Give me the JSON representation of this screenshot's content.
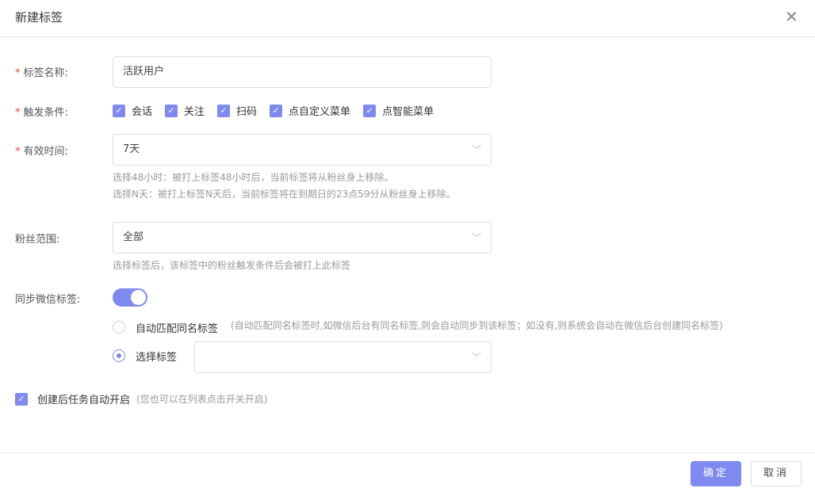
{
  "dialog": {
    "title": "新建标签"
  },
  "form": {
    "name": {
      "label": "标签名称:",
      "value": "活跃用户"
    },
    "trigger": {
      "label": "触发条件:",
      "options": [
        "会话",
        "关注",
        "扫码",
        "点自定义菜单",
        "点智能菜单"
      ]
    },
    "validity": {
      "label": "有效时间:",
      "value": "7天",
      "hint1": "选择48小时：被打上标签48小时后，当前标签将从粉丝身上移除。",
      "hint2": "选择N天：被打上标签N天后，当前标签将在到期日的23点59分从粉丝身上移除。"
    },
    "fans": {
      "label": "粉丝范围:",
      "value": "全部",
      "hint": "选择标签后，该标签中的粉丝触发条件后会被打上此标签"
    },
    "sync": {
      "label": "同步微信标签:",
      "auto_label": "自动匹配同名标签",
      "auto_hint": "(自动匹配同名标签时,如微信后台有同名标签,则会自动同步到该标签；如没有,则系统会自动在微信后台创建同名标签)",
      "select_label": "选择标签",
      "select_value": ""
    },
    "auto_start": {
      "label": "创建后任务自动开启",
      "hint": "(您也可以在列表点击开关开启)"
    }
  },
  "footer": {
    "ok": "确定",
    "cancel": "取消"
  },
  "colors": {
    "accent": "#7f8af0"
  }
}
